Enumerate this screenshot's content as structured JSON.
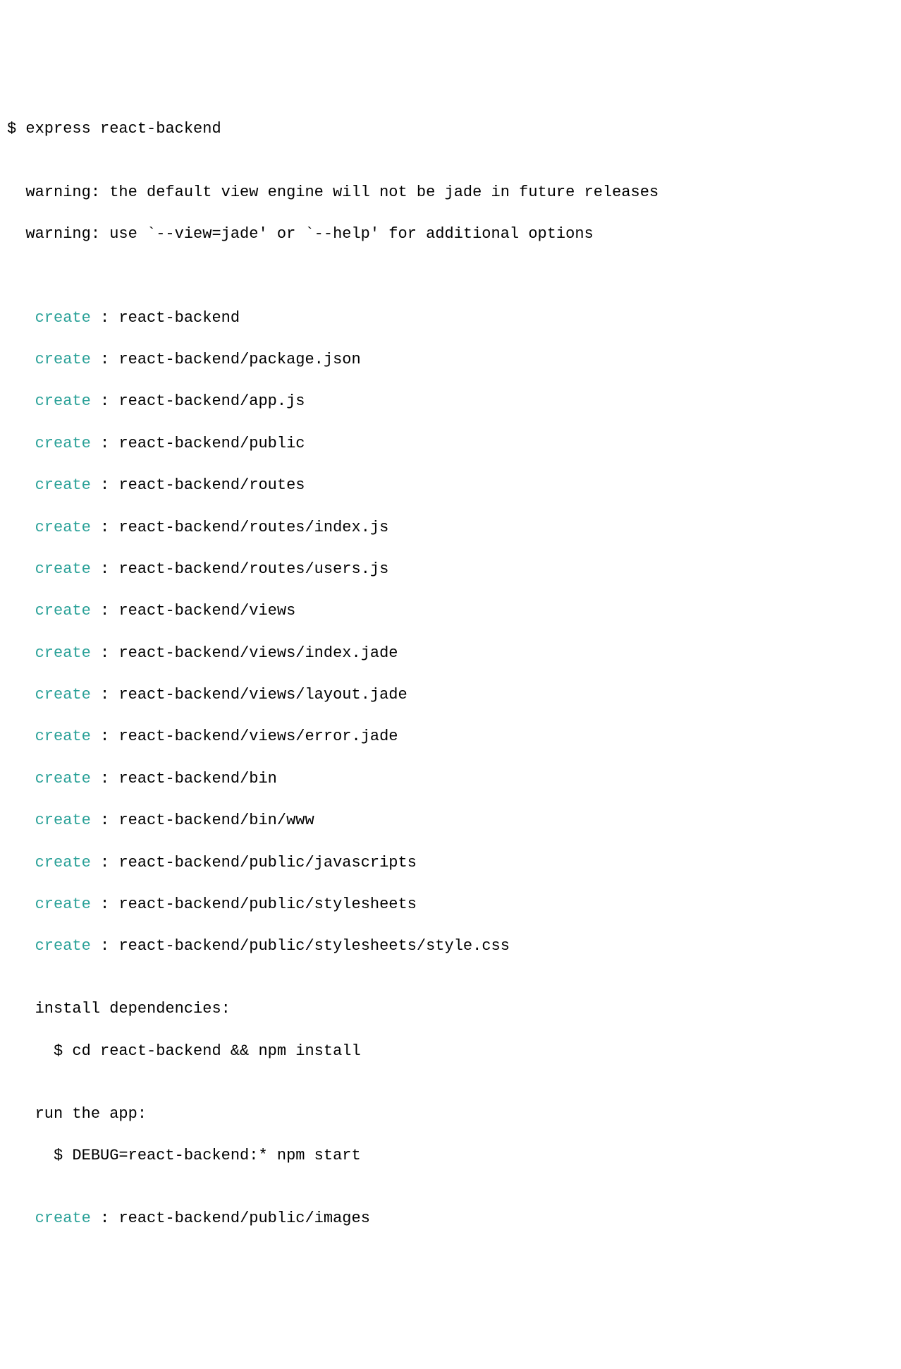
{
  "prompt": "$ ",
  "command": "express react-backend",
  "blank": "",
  "warnings": [
    "  warning: the default view engine will not be jade in future releases",
    "  warning: use `--view=jade' or `--help' for additional options"
  ],
  "createLabelPadded": "   create",
  "sep": " : ",
  "creates": [
    "react-backend",
    "react-backend/package.json",
    "react-backend/app.js",
    "react-backend/public",
    "react-backend/routes",
    "react-backend/routes/index.js",
    "react-backend/routes/users.js",
    "react-backend/views",
    "react-backend/views/index.jade",
    "react-backend/views/layout.jade",
    "react-backend/views/error.jade",
    "react-backend/bin",
    "react-backend/bin/www",
    "react-backend/public/javascripts",
    "react-backend/public/stylesheets",
    "react-backend/public/stylesheets/style.css"
  ],
  "installHeader": "   install dependencies:",
  "installCmd": "     $ cd react-backend && npm install",
  "runHeader": "   run the app:",
  "runCmd": "     $ DEBUG=react-backend:* npm start",
  "trailingCreate": "react-backend/public/images"
}
